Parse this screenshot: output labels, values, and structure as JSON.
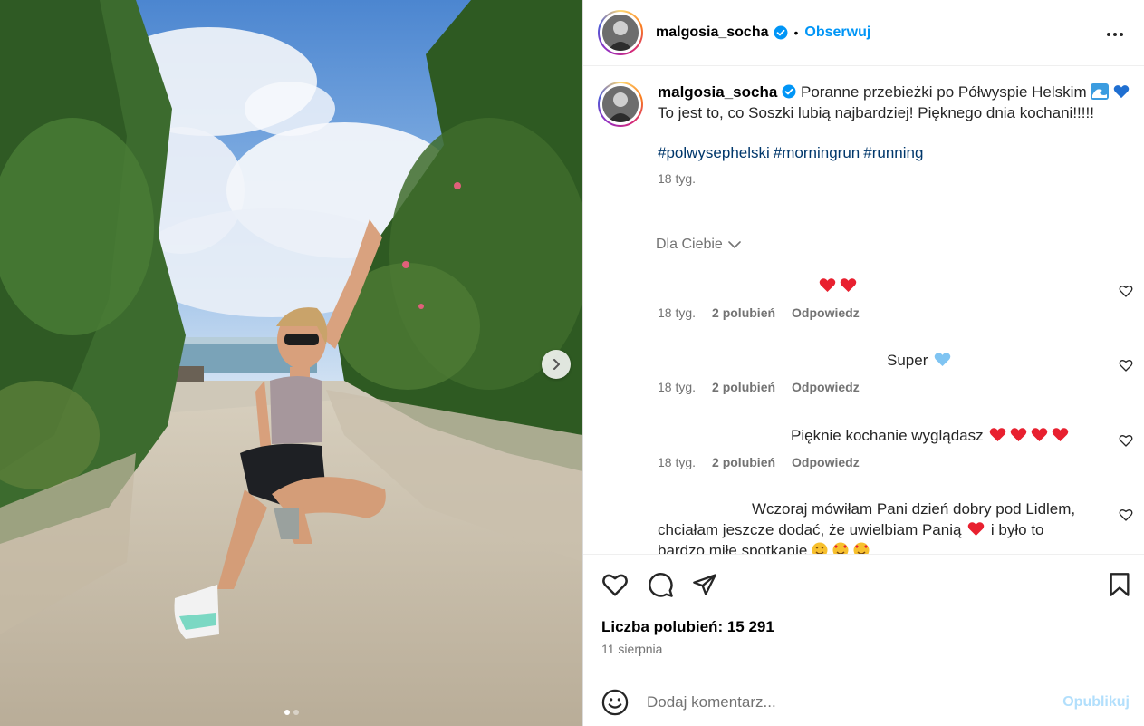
{
  "post": {
    "username": "malgosia_socha",
    "follow_label": "Obserwuj",
    "separator": "•",
    "more_icon": "more-icon"
  },
  "caption": {
    "username": "malgosia_socha",
    "text_part1": "Poranne przebieżki po Półwyspie Helskim",
    "text_part2": "To jest to, co Soszki lubią najbardziej! Pięknego dnia kochani!!!!!",
    "hashtags": [
      "#polwysephelski",
      "#morningrun",
      "#running"
    ],
    "time": "18 tyg."
  },
  "for_you": "Dla Ciebie",
  "comments": [
    {
      "text": "",
      "emoji": [
        "red-heart",
        "red-heart"
      ],
      "time": "18 tyg.",
      "likes": "2 polubień",
      "reply": "Odpowiedz"
    },
    {
      "text": "Super",
      "emoji": [
        "light-blue-heart"
      ],
      "time": "18 tyg.",
      "likes": "2 polubień",
      "reply": "Odpowiedz"
    },
    {
      "text": "Pięknie kochanie wyglądasz",
      "emoji": [
        "red-heart",
        "red-heart",
        "red-heart",
        "red-heart"
      ],
      "time": "18 tyg.",
      "likes": "2 polubień",
      "reply": "Odpowiedz"
    },
    {
      "text_line1": "Wczoraj mówiłam Pani dzień dobry pod Lidlem,",
      "text_line2a": "chciałam jeszcze dodać, że uwielbiam Panią",
      "text_line2b": "i było to",
      "text_line3": "bardzo miłe spotkanie"
    }
  ],
  "stats": {
    "likes": "Liczba polubień: 15 291",
    "date": "11 sierpnia"
  },
  "add_comment": {
    "placeholder": "Dodaj komentarz...",
    "publish": "Opublikuj"
  },
  "carousel": {
    "total": 2,
    "active": 1
  },
  "colors": {
    "link": "#0095f6",
    "hashtag": "#00376b",
    "muted": "#737373",
    "heart": "#ff3040",
    "publish_disabled": "#b2dffc"
  }
}
